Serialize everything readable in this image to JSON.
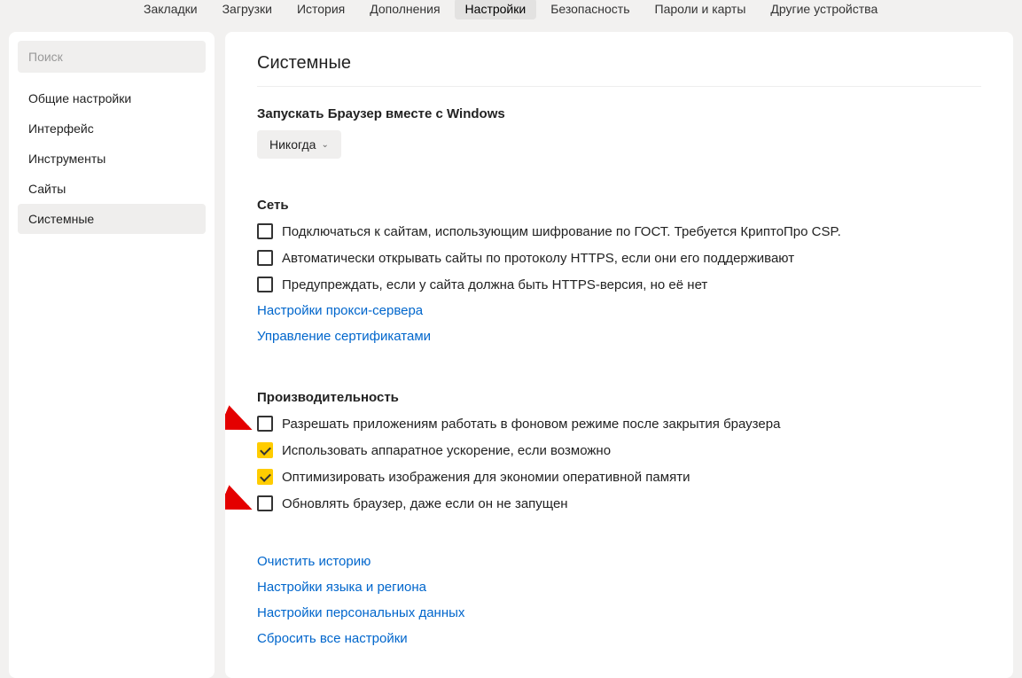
{
  "topnav": {
    "tabs": [
      {
        "label": "Закладки",
        "active": false
      },
      {
        "label": "Загрузки",
        "active": false
      },
      {
        "label": "История",
        "active": false
      },
      {
        "label": "Дополнения",
        "active": false
      },
      {
        "label": "Настройки",
        "active": true
      },
      {
        "label": "Безопасность",
        "active": false
      },
      {
        "label": "Пароли и карты",
        "active": false
      },
      {
        "label": "Другие устройства",
        "active": false
      }
    ]
  },
  "sidebar": {
    "search_placeholder": "Поиск",
    "items": [
      {
        "label": "Общие настройки",
        "active": false
      },
      {
        "label": "Интерфейс",
        "active": false
      },
      {
        "label": "Инструменты",
        "active": false
      },
      {
        "label": "Сайты",
        "active": false
      },
      {
        "label": "Системные",
        "active": true
      }
    ]
  },
  "main": {
    "title": "Системные",
    "startup": {
      "heading": "Запускать Браузер вместе с Windows",
      "select_value": "Никогда"
    },
    "network": {
      "heading": "Сеть",
      "opts": [
        {
          "label": "Подключаться к сайтам, использующим шифрование по ГОСТ. Требуется КриптоПро CSP.",
          "checked": false
        },
        {
          "label": "Автоматически открывать сайты по протоколу HTTPS, если они его поддерживают",
          "checked": false
        },
        {
          "label": "Предупреждать, если у сайта должна быть HTTPS-версия, но её нет",
          "checked": false
        }
      ],
      "links": [
        "Настройки прокси-сервера",
        "Управление сертификатами"
      ]
    },
    "performance": {
      "heading": "Производительность",
      "opts": [
        {
          "label": "Разрешать приложениям работать в фоновом режиме после закрытия браузера",
          "checked": false,
          "annotated": true
        },
        {
          "label": "Использовать аппаратное ускорение, если возможно",
          "checked": true
        },
        {
          "label": "Оптимизировать изображения для экономии оперативной памяти",
          "checked": true
        },
        {
          "label": "Обновлять браузер, даже если он не запущен",
          "checked": false,
          "annotated": true
        }
      ]
    },
    "bottom_links": [
      "Очистить историю",
      "Настройки языка и региона",
      "Настройки персональных данных",
      "Сбросить все настройки"
    ]
  }
}
